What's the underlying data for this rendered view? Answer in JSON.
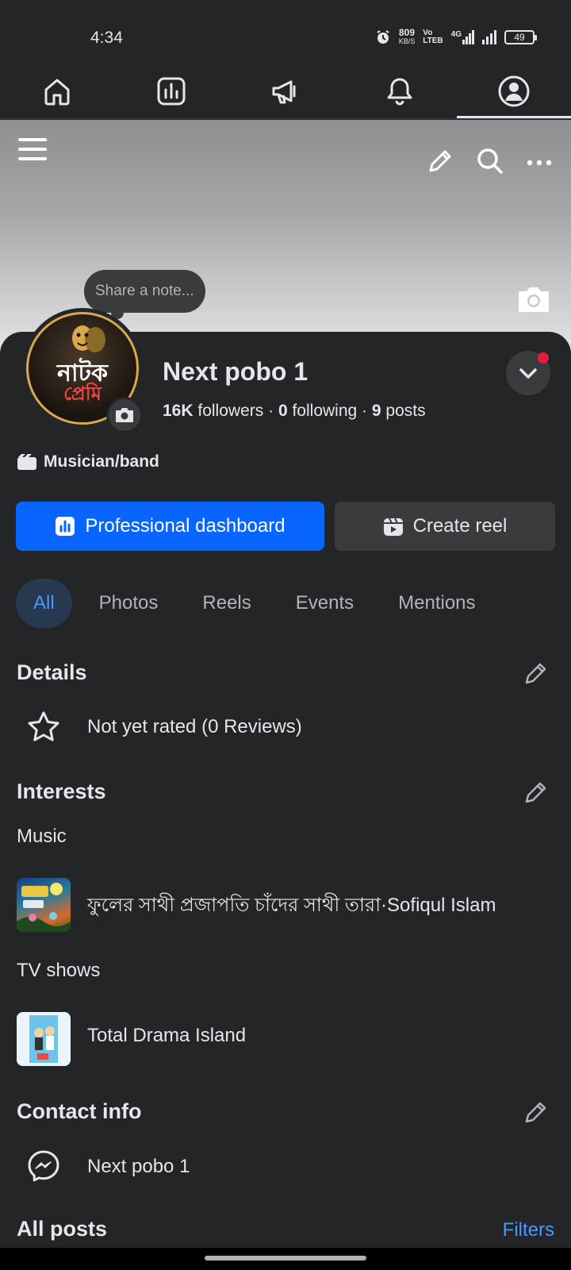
{
  "status_bar": {
    "time": "4:34",
    "speed_value": "809",
    "speed_unit": "KB/S",
    "volte_top": "Vo",
    "volte_bottom": "LTEB",
    "network": "4G",
    "battery": "49"
  },
  "top_nav": {
    "tabs": [
      {
        "icon": "home-icon"
      },
      {
        "icon": "dashboard-icon"
      },
      {
        "icon": "megaphone-icon"
      },
      {
        "icon": "bell-icon"
      },
      {
        "icon": "profile-icon",
        "active": true
      }
    ]
  },
  "note": {
    "placeholder": "Share a note..."
  },
  "profile": {
    "name": "Next pobo 1",
    "followers_count": "16K",
    "followers_label": "followers",
    "following_count": "0",
    "following_label": "following",
    "posts_count": "9",
    "posts_label": "posts",
    "separator": "·",
    "category": "Musician/band",
    "avatar_text_line1": "নাটক",
    "avatar_text_line2": "প্রেমি"
  },
  "buttons": {
    "primary": "Professional dashboard",
    "secondary": "Create reel"
  },
  "filter_tabs": [
    "All",
    "Photos",
    "Reels",
    "Events",
    "Mentions"
  ],
  "details": {
    "title": "Details",
    "rating": "Not yet rated (0 Reviews)"
  },
  "interests": {
    "title": "Interests",
    "music_label": "Music",
    "music_item": "ফুলের সাথী প্রজাপতি চাঁদের সাথী তারা·Sofiqul Islam",
    "tv_label": "TV shows",
    "tv_item": "Total Drama Island"
  },
  "contact": {
    "title": "Contact info",
    "messenger": "Next pobo 1"
  },
  "all_posts": {
    "title": "All posts",
    "filters_link": "Filters"
  },
  "colors": {
    "background": "#242526",
    "primary_button": "#0866ff",
    "accent_link": "#4599ff",
    "notification_dot": "#e41e3f"
  }
}
